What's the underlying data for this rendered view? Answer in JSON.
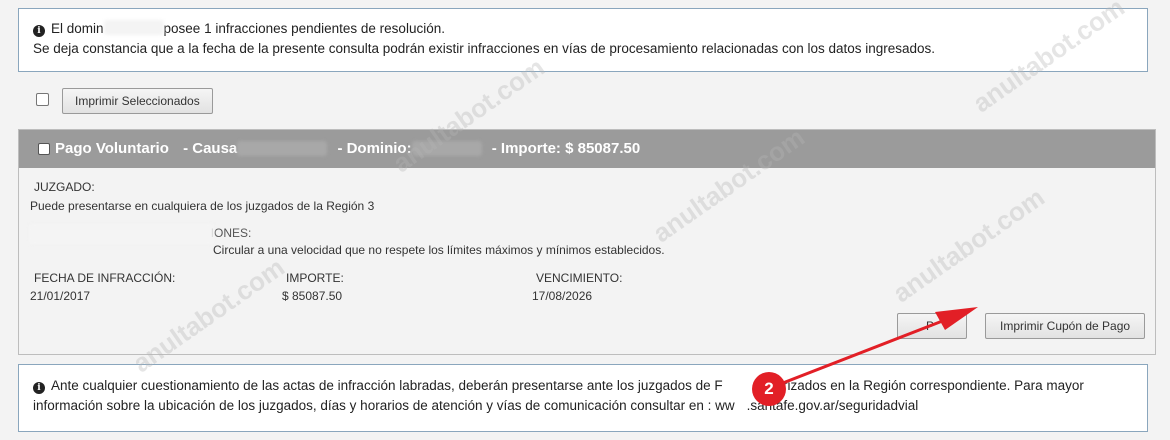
{
  "top_notice": {
    "line1_prefix": "El domin",
    "line1_suffix": "posee 1 infracciones pendientes de resolución.",
    "line2": "Se deja constancia que a la fecha de la presente consulta podrán existir infracciones en vías de procesamiento relacionadas con los datos ingresados."
  },
  "toolbar": {
    "print_selected_label": "Imprimir Seleccionados"
  },
  "infraction": {
    "header": {
      "type": "Pago Voluntario",
      "causa_label": "-  Causa",
      "dominio_label": "-  Dominio:",
      "importe_label": "-  Importe: $ 85087.50"
    },
    "juzgado_label": "JUZGADO:",
    "juzgado_text": "Puede presentarse en cualquiera de los juzgados de la Región 3",
    "dominio_causas_label": "DOMINIO - CAUSAS - INFRACCIONES:",
    "infraccion_text": "Circular a una velocidad que no respete los límites máximos y mínimos establecidos.",
    "fecha_label": "FECHA DE INFRACCIÓN:",
    "fecha_value": "21/01/2017",
    "importe_label": "IMPORTE:",
    "importe_value": "$ 85087.50",
    "vencimiento_label": "VENCIMIENTO:",
    "vencimiento_value": "17/08/2026",
    "pay_button_label": "P",
    "print_coupon_label": "Imprimir Cupón de Pago"
  },
  "bottom_notice": {
    "line1_a": "Ante cualquier cuestionamiento de las actas de infracción labradas, deberán presentarse ante los juzgados de F",
    "line1_b": "autorizados en la Región correspondiente. Para mayor",
    "line2_a": "información sobre la ubicación de los juzgados, días y horarios de atención y vías de comunicación consultar en : ww",
    "line2_b": ".santafe.gov.ar/seguridadvial"
  },
  "annotation": {
    "step_number": "2",
    "color": "#e21f26"
  },
  "watermark": "anultabot.com"
}
